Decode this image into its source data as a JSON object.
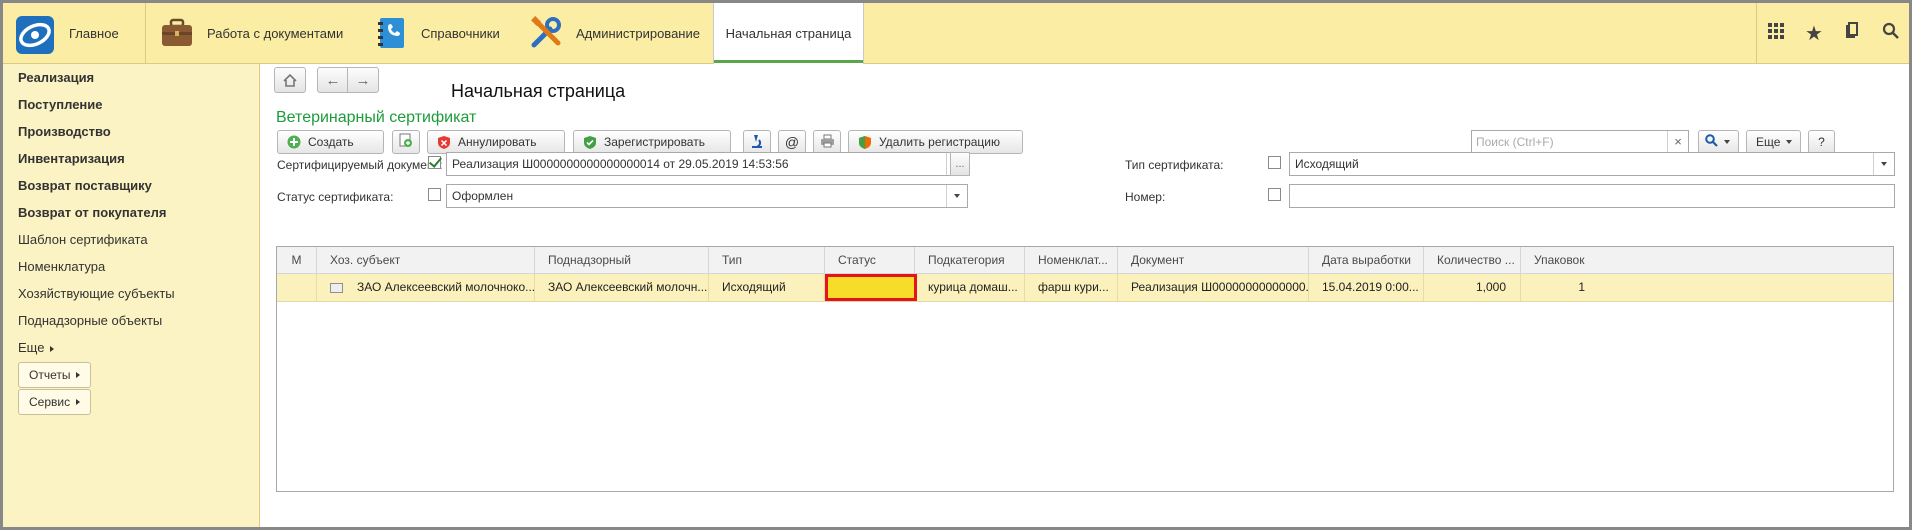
{
  "sections": [
    {
      "label": "Главное",
      "icon": "logo-icon"
    },
    {
      "label": "Работа с документами",
      "icon": "briefcase-icon"
    },
    {
      "label": "Справочники",
      "icon": "phonebook-icon"
    },
    {
      "label": "Администрирование",
      "icon": "tools-icon"
    },
    {
      "label": "Начальная страница",
      "icon": ""
    }
  ],
  "top_right_icons": [
    "grid-icon",
    "star-icon",
    "history-icon",
    "search-icon"
  ],
  "sidebar": {
    "items": [
      {
        "label": "Реализация",
        "bold": true
      },
      {
        "label": "Поступление",
        "bold": true
      },
      {
        "label": "Производство",
        "bold": true
      },
      {
        "label": "Инвентаризация",
        "bold": true
      },
      {
        "label": "Возврат поставщику",
        "bold": true
      },
      {
        "label": "Возврат от покупателя",
        "bold": true
      },
      {
        "label": "Шаблон сертификата",
        "bold": false
      },
      {
        "label": "Номенклатура",
        "bold": false
      },
      {
        "label": "Хозяйствующие субъекты",
        "bold": false
      },
      {
        "label": "Поднадзорные объекты",
        "bold": false
      },
      {
        "label": "Еще",
        "bold": false
      }
    ],
    "reports_label": "Отчеты",
    "service_label": "Сервис"
  },
  "page": {
    "title": "Начальная страница",
    "form_title": "Ветеринарный сертификат"
  },
  "toolbar": {
    "create_label": "Создать",
    "annul_label": "Аннулировать",
    "register_label": "Зарегистрировать",
    "at_label": "@",
    "delete_reg_label": "Удалить регистрацию",
    "search_placeholder": "Поиск (Ctrl+F)",
    "search_clear": "×",
    "more_label": "Еще",
    "help_label": "?"
  },
  "filters": {
    "doc_label": "Сертифицируемый документ:",
    "doc_checked": true,
    "doc_value": "Реализация Ш0000000000000000014 от 29.05.2019 14:53:56",
    "doc_more": "...",
    "type_label": "Тип сертификата:",
    "type_checked": false,
    "type_value": "Исходящий",
    "status_label": "Статус сертификата:",
    "status_checked": false,
    "status_value": "Оформлен",
    "number_label": "Номер:",
    "number_checked": false,
    "number_value": ""
  },
  "table": {
    "headers": [
      "М",
      "Хоз. субъект",
      "Поднадзорный",
      "Тип",
      "Статус",
      "Подкатегория",
      "Номенклат...",
      "Документ",
      "Дата выработки",
      "Количество ...",
      "Упаковок"
    ],
    "rows": [
      [
        "",
        "ЗАО  Алексеевский молочноко...",
        "ЗАО Алексеевский молочн...",
        "Исходящий",
        "",
        "курица домаш...",
        "фарш кури...",
        "Реализация Ш00000000000000...",
        "15.04.2019 0:00...",
        "1,000",
        "1"
      ]
    ],
    "status_highlight": "#f7dc2a",
    "highlight_border": "#e5141a"
  },
  "colors": {
    "accent_green": "#1c9b3a",
    "panel_yellow": "#fbf3c3",
    "topbar_yellow": "#fbeea4",
    "selected_row": "#fbf1bc"
  }
}
